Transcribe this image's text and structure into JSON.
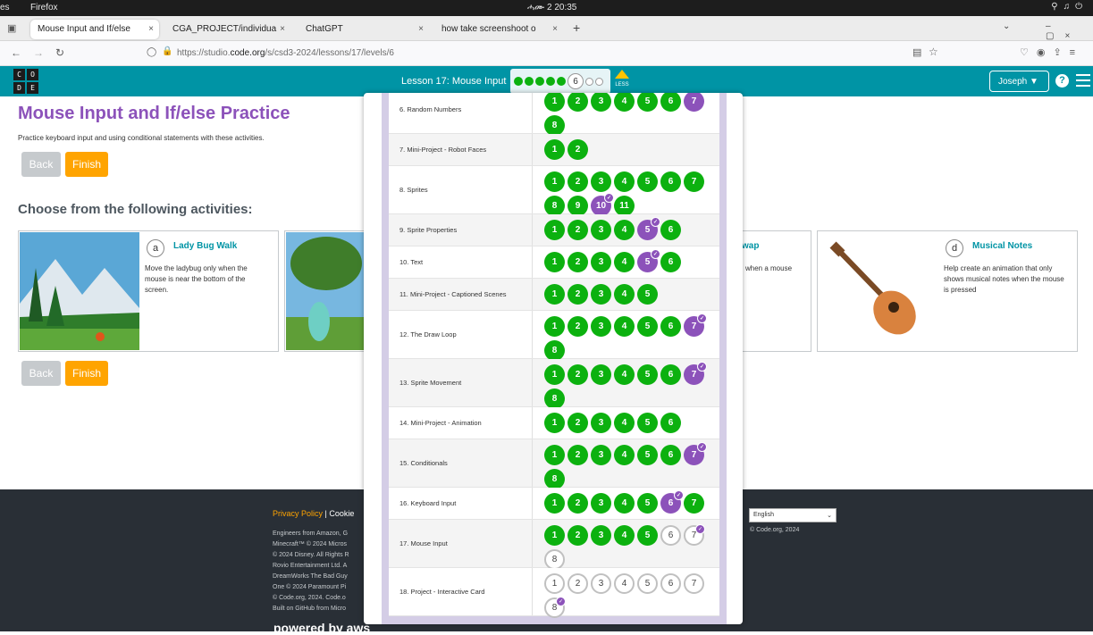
{
  "os": {
    "left_label": "es",
    "app": "Firefox",
    "clock": "ሓሙ 2  20:35"
  },
  "browser": {
    "tabs": [
      {
        "label": "Mouse Input and If/else"
      },
      {
        "label": "CGA_PROJECT/individua"
      },
      {
        "label": "ChatGPT"
      },
      {
        "label": "how take screenshoot o"
      }
    ],
    "url_prefix": "https://studio.",
    "url_domain": "code.org",
    "url_path": "/s/csd3-2024/lessons/17/levels/6"
  },
  "header": {
    "logo": [
      "C",
      "O",
      "D",
      "E"
    ],
    "lesson_title": "Lesson 17: Mouse Input",
    "current_level": "6",
    "less_label": "LESS",
    "user_name": "Joseph",
    "help_label": "?"
  },
  "page": {
    "title": "Mouse Input and If/else Practice",
    "description": "Practice keyboard input and using conditional statements with these activities.",
    "back_label": "Back",
    "finish_label": "Finish",
    "choose_heading": "Choose from the following activities:"
  },
  "cards": [
    {
      "letter": "a",
      "title": "Lady Bug Walk",
      "desc": "Move the ladybug only when the mouse is near the bottom of the screen."
    },
    {
      "letter": "",
      "title": "wap",
      "desc": "when a mouse"
    },
    {
      "letter": "d",
      "title": "Musical Notes",
      "desc": "Help create an animation that only shows musical notes when the mouse is pressed"
    }
  ],
  "footer": {
    "privacy": "Privacy Policy",
    "sep": " | ",
    "cookie": "Cookie",
    "legal": [
      "Engineers from Amazon, G",
      "Minecraft™ © 2024 Micros",
      "© 2024 Disney. All Rights R",
      "Rovio Entertainment Ltd. A",
      "DreamWorks The Bad Guy",
      "One © 2024 Paramount Pi",
      "© Code.org, 2024. Code.o",
      "Built on GitHub from Micro"
    ],
    "language": "English",
    "copyright": "© Code.org, 2024",
    "powered": "powered by aws"
  },
  "lessons": [
    {
      "name": "6. Random Numbers",
      "levels": [
        {
          "n": "1",
          "s": "g"
        },
        {
          "n": "2",
          "s": "g"
        },
        {
          "n": "3",
          "s": "g"
        },
        {
          "n": "4",
          "s": "g"
        },
        {
          "n": "5",
          "s": "g"
        },
        {
          "n": "6",
          "s": "g"
        },
        {
          "n": "7",
          "s": "p"
        },
        {
          "n": "8",
          "s": "g"
        }
      ]
    },
    {
      "name": "7. Mini-Project - Robot Faces",
      "levels": [
        {
          "n": "1",
          "s": "g"
        },
        {
          "n": "2",
          "s": "g"
        }
      ]
    },
    {
      "name": "8. Sprites",
      "levels": [
        {
          "n": "1",
          "s": "g"
        },
        {
          "n": "2",
          "s": "g"
        },
        {
          "n": "3",
          "s": "g"
        },
        {
          "n": "4",
          "s": "g"
        },
        {
          "n": "5",
          "s": "g"
        },
        {
          "n": "6",
          "s": "g"
        },
        {
          "n": "7",
          "s": "g"
        },
        {
          "n": "8",
          "s": "g"
        },
        {
          "n": "9",
          "s": "g"
        },
        {
          "n": "10",
          "s": "p",
          "c": true
        },
        {
          "n": "11",
          "s": "g"
        }
      ]
    },
    {
      "name": "9. Sprite Properties",
      "levels": [
        {
          "n": "1",
          "s": "g"
        },
        {
          "n": "2",
          "s": "g"
        },
        {
          "n": "3",
          "s": "g"
        },
        {
          "n": "4",
          "s": "g"
        },
        {
          "n": "5",
          "s": "p",
          "c": true
        },
        {
          "n": "6",
          "s": "g"
        }
      ]
    },
    {
      "name": "10. Text",
      "levels": [
        {
          "n": "1",
          "s": "g"
        },
        {
          "n": "2",
          "s": "g"
        },
        {
          "n": "3",
          "s": "g"
        },
        {
          "n": "4",
          "s": "g"
        },
        {
          "n": "5",
          "s": "p",
          "c": true
        },
        {
          "n": "6",
          "s": "g"
        }
      ]
    },
    {
      "name": "11. Mini-Project - Captioned Scenes",
      "levels": [
        {
          "n": "1",
          "s": "g"
        },
        {
          "n": "2",
          "s": "g"
        },
        {
          "n": "3",
          "s": "g"
        },
        {
          "n": "4",
          "s": "g"
        },
        {
          "n": "5",
          "s": "g"
        }
      ]
    },
    {
      "name": "12. The Draw Loop",
      "levels": [
        {
          "n": "1",
          "s": "g"
        },
        {
          "n": "2",
          "s": "g"
        },
        {
          "n": "3",
          "s": "g"
        },
        {
          "n": "4",
          "s": "g"
        },
        {
          "n": "5",
          "s": "g"
        },
        {
          "n": "6",
          "s": "g"
        },
        {
          "n": "7",
          "s": "p",
          "c": true
        },
        {
          "n": "8",
          "s": "g"
        }
      ]
    },
    {
      "name": "13. Sprite Movement",
      "levels": [
        {
          "n": "1",
          "s": "g"
        },
        {
          "n": "2",
          "s": "g"
        },
        {
          "n": "3",
          "s": "g"
        },
        {
          "n": "4",
          "s": "g"
        },
        {
          "n": "5",
          "s": "g"
        },
        {
          "n": "6",
          "s": "g"
        },
        {
          "n": "7",
          "s": "p",
          "c": true
        },
        {
          "n": "8",
          "s": "g"
        }
      ]
    },
    {
      "name": "14. Mini-Project - Animation",
      "levels": [
        {
          "n": "1",
          "s": "g"
        },
        {
          "n": "2",
          "s": "g"
        },
        {
          "n": "3",
          "s": "g"
        },
        {
          "n": "4",
          "s": "g"
        },
        {
          "n": "5",
          "s": "g"
        },
        {
          "n": "6",
          "s": "g"
        }
      ]
    },
    {
      "name": "15. Conditionals",
      "levels": [
        {
          "n": "1",
          "s": "g"
        },
        {
          "n": "2",
          "s": "g"
        },
        {
          "n": "3",
          "s": "g"
        },
        {
          "n": "4",
          "s": "g"
        },
        {
          "n": "5",
          "s": "g"
        },
        {
          "n": "6",
          "s": "g"
        },
        {
          "n": "7",
          "s": "p",
          "c": true
        },
        {
          "n": "8",
          "s": "g"
        }
      ]
    },
    {
      "name": "16. Keyboard Input",
      "levels": [
        {
          "n": "1",
          "s": "g"
        },
        {
          "n": "2",
          "s": "g"
        },
        {
          "n": "3",
          "s": "g"
        },
        {
          "n": "4",
          "s": "g"
        },
        {
          "n": "5",
          "s": "g"
        },
        {
          "n": "6",
          "s": "p",
          "c": true
        },
        {
          "n": "7",
          "s": "g"
        }
      ]
    },
    {
      "name": "17. Mouse Input",
      "levels": [
        {
          "n": "1",
          "s": "g"
        },
        {
          "n": "2",
          "s": "g"
        },
        {
          "n": "3",
          "s": "g"
        },
        {
          "n": "4",
          "s": "g"
        },
        {
          "n": "5",
          "s": "g"
        },
        {
          "n": "6",
          "s": "w"
        },
        {
          "n": "7",
          "s": "w",
          "c": true
        },
        {
          "n": "8",
          "s": "w"
        }
      ]
    },
    {
      "name": "18. Project - Interactive Card",
      "levels": [
        {
          "n": "1",
          "s": "w"
        },
        {
          "n": "2",
          "s": "w"
        },
        {
          "n": "3",
          "s": "w"
        },
        {
          "n": "4",
          "s": "w"
        },
        {
          "n": "5",
          "s": "w"
        },
        {
          "n": "6",
          "s": "w"
        },
        {
          "n": "7",
          "s": "w"
        },
        {
          "n": "8",
          "s": "w",
          "c": true
        }
      ]
    }
  ],
  "colors": {
    "teal": "#0094a5",
    "purple": "#8c52ba",
    "green": "#0cb10f",
    "orange": "#ffa400"
  }
}
